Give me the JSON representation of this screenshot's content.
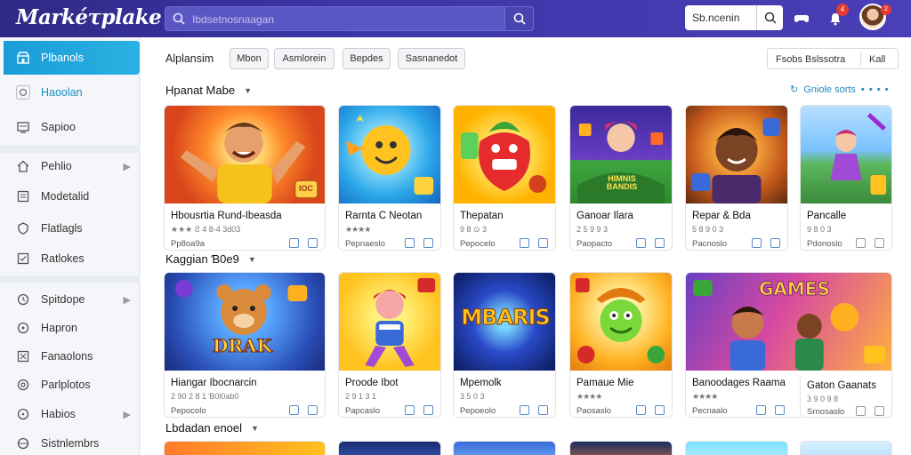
{
  "app": {
    "title": "Markéτplake"
  },
  "header": {
    "search_placeholder": "Ibdsetnosnaagan",
    "search2_label": "Sb.ncenin",
    "notif_count": "4",
    "avatar_badge": "2"
  },
  "sidebar": {
    "items": [
      {
        "label": "Plbanols",
        "icon": "store-icon"
      },
      {
        "label": "Haoolan",
        "icon": "square-icon"
      },
      {
        "label": "Sapioo",
        "icon": "monitor-icon"
      },
      {
        "label": "Pehlio",
        "icon": "home-icon"
      },
      {
        "label": "Modetalid",
        "icon": "list-icon"
      },
      {
        "label": "Flatlagls",
        "icon": "shield-icon"
      },
      {
        "label": "Ratlokes",
        "icon": "box-icon"
      },
      {
        "label": "Spitdope",
        "icon": "clock-icon"
      },
      {
        "label": "Hapron",
        "icon": "circle-icon"
      },
      {
        "label": "Fanaolons",
        "icon": "flag-icon"
      },
      {
        "label": "Parlplotos",
        "icon": "gear-icon"
      },
      {
        "label": "Habios",
        "icon": "info-icon"
      },
      {
        "label": "Sistnlembrs",
        "icon": "globe-icon"
      }
    ]
  },
  "filters": {
    "label": "Alplansim",
    "chips": [
      "Mbon",
      "Asmlorein",
      "Bepdes",
      "Sasnanedot"
    ],
    "sort_label": "Fsobs Bslssotra",
    "sort_value": "Kall"
  },
  "sections": [
    {
      "title": "Hpanat Mabe"
    },
    {
      "title": "Kaggian Ɓ0e9"
    },
    {
      "title": "Lbdadan enoel"
    }
  ],
  "guide": {
    "label": "Gniole sorts",
    "dots": "• • • •"
  },
  "row1": [
    {
      "title": "Hbousrtia Rund-Ibeasda",
      "meta": "★★★ Ƨ 4 8-4 3d03",
      "sub": "Pp8oa9a",
      "stars": true
    },
    {
      "title": "Rarnta C Neotan",
      "meta": "★★★★",
      "sub": "Pepnaeslo",
      "stars": true
    },
    {
      "title": "Thepatan",
      "meta": "9 8 ⊙ 3",
      "sub": "Pepocelo",
      "stars": false
    },
    {
      "title": "Ganoar Ilara",
      "meta": "2 5 9 9 3",
      "sub": "Paopacto",
      "stars": false
    },
    {
      "title": "Repar & Bda",
      "meta": "5 8 9 0 3",
      "sub": "Pacnoslo",
      "stars": false
    },
    {
      "title": "Pancalle",
      "meta": "9 8 0 3",
      "sub": "Pdonoslo",
      "stars": false
    }
  ],
  "row2": [
    {
      "title": "Hiangar Ibocnarcin",
      "meta": "2 90 2 8 1 Ɓ0l0ab0",
      "sub": "Pepocolo",
      "stars": false
    },
    {
      "title": "Proode Ibot",
      "meta": "2 9 1 3 1",
      "sub": "Papcaslo",
      "stars": false
    },
    {
      "title": "Mpemolk",
      "meta": "3 5 0 3",
      "sub": "Pepoeolo",
      "stars": false
    },
    {
      "title": "Pamaue Mie",
      "meta": "★★★★",
      "sub": "Paosaslo",
      "stars": true
    },
    {
      "title": "Banoodages Raama",
      "meta": "★★★★",
      "sub": "Pecnaalo",
      "stars": true
    },
    {
      "title": "Gaton Gaanats",
      "meta": "3 9 0 9 8",
      "sub": "Srnosaslo",
      "stars": false
    }
  ],
  "art": {
    "row2_card3_text": "MBARIS",
    "row2_card5_text": "GAMES",
    "row2_card1_text": "DRAK",
    "row1_card4_text": "HIMNIS BANDIS",
    "row1_card1_badge": "IOC"
  },
  "colors": {
    "topbar": "#3c36a8",
    "accent": "#1b9cd8",
    "star": "#f0b400"
  }
}
